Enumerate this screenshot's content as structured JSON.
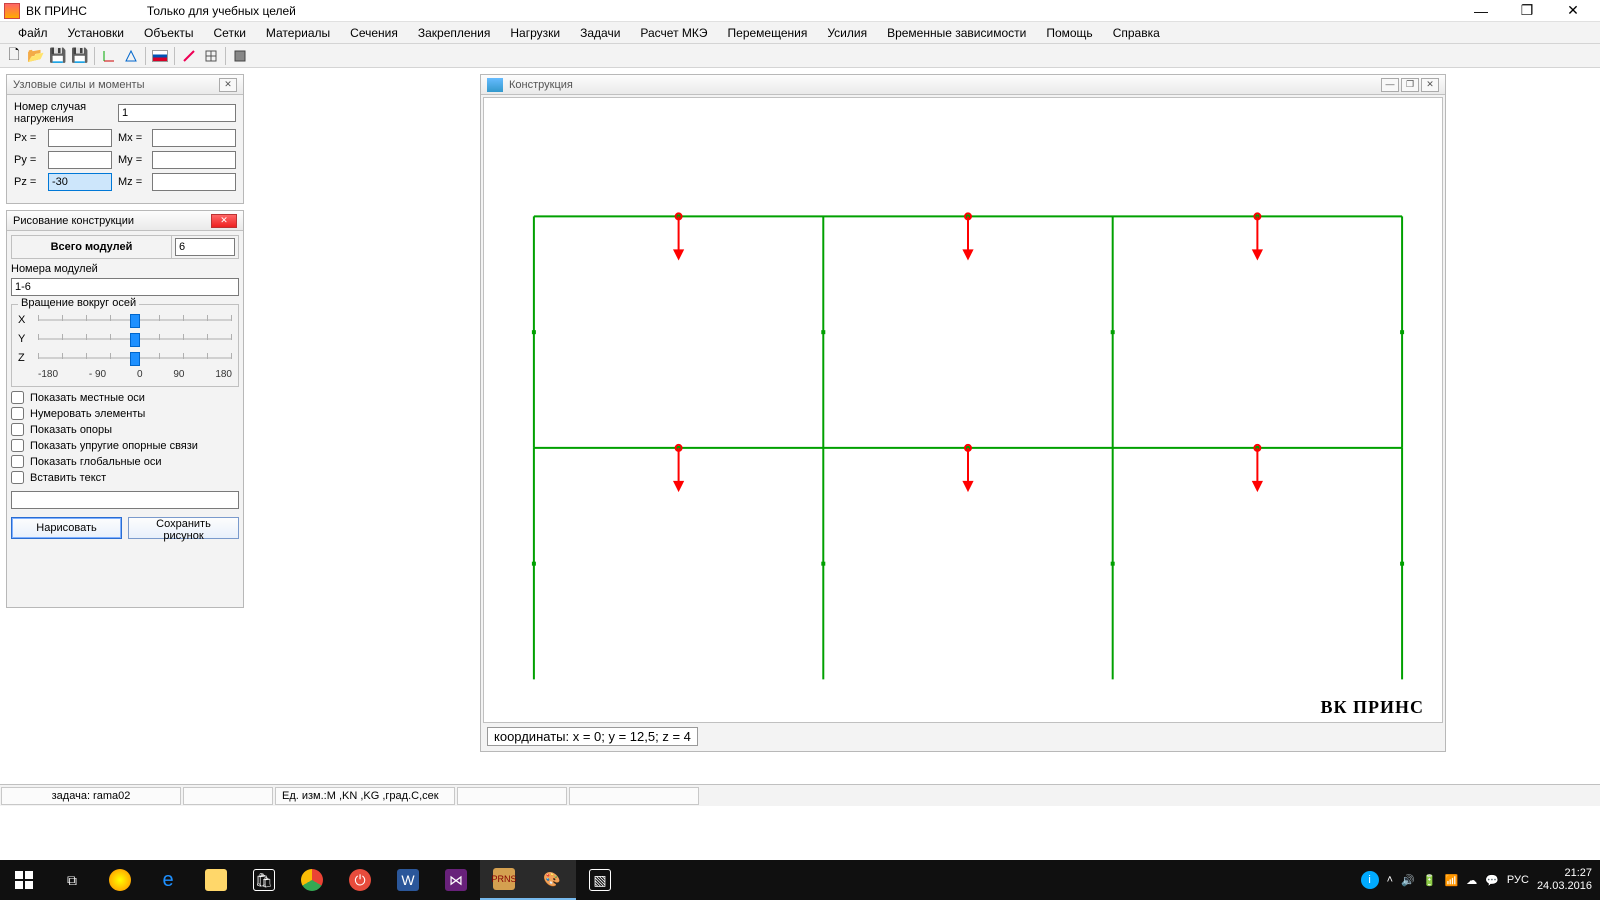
{
  "titlebar": {
    "app": "ВК ПРИНС",
    "subtitle": "Только для учебных целей"
  },
  "menu": [
    "Файл",
    "Установки",
    "Объекты",
    "Сетки",
    "Материалы",
    "Сечения",
    "Закрепления",
    "Нагрузки",
    "Задачи",
    "Расчет МКЭ",
    "Перемещения",
    "Усилия",
    "Временные зависимости",
    "Помощь",
    "Справка"
  ],
  "panel_forces": {
    "title": "Узловые силы и моменты",
    "load_case_label": "Номер случая нагружения",
    "load_case_value": "1",
    "rows": [
      {
        "l1": "Px =",
        "v1": "",
        "l2": "Mx =",
        "v2": ""
      },
      {
        "l1": "Py =",
        "v1": "",
        "l2": "My =",
        "v2": ""
      },
      {
        "l1": "Pz =",
        "v1": "-30",
        "l2": "Mz =",
        "v2": "",
        "sel": true
      }
    ]
  },
  "panel_draw": {
    "title": "Рисование конструкции",
    "total_modules_label": "Всего модулей",
    "total_modules_value": "6",
    "module_numbers_label": "Номера модулей",
    "module_numbers_value": "1-6",
    "rotation_legend": "Вращение вокруг осей",
    "axes": [
      "X",
      "Y",
      "Z"
    ],
    "scale": [
      "-180",
      "- 90",
      "0",
      "90",
      "180"
    ],
    "checks": [
      "Показать местные оси",
      "Нумеровать элементы",
      "Показать опоры",
      "Показать упругие опорные связи",
      "Показать глобальные оси",
      "Вставить текст"
    ],
    "text_value": "",
    "btn_draw": "Нарисовать",
    "btn_save": "Сохранить рисунок"
  },
  "mdi": {
    "title": "Конструкция",
    "watermark": "ВК  ПРИНС",
    "coord_label": "координаты:   x = 0; y = 12,5; z = 4"
  },
  "status": {
    "task": "задача: rama02",
    "units": "Ед. изм.:M ,KN  ,KG  ,град.C,сек"
  },
  "tray": {
    "lang": "РУС",
    "time": "21:27",
    "date": "24.03.2016"
  }
}
